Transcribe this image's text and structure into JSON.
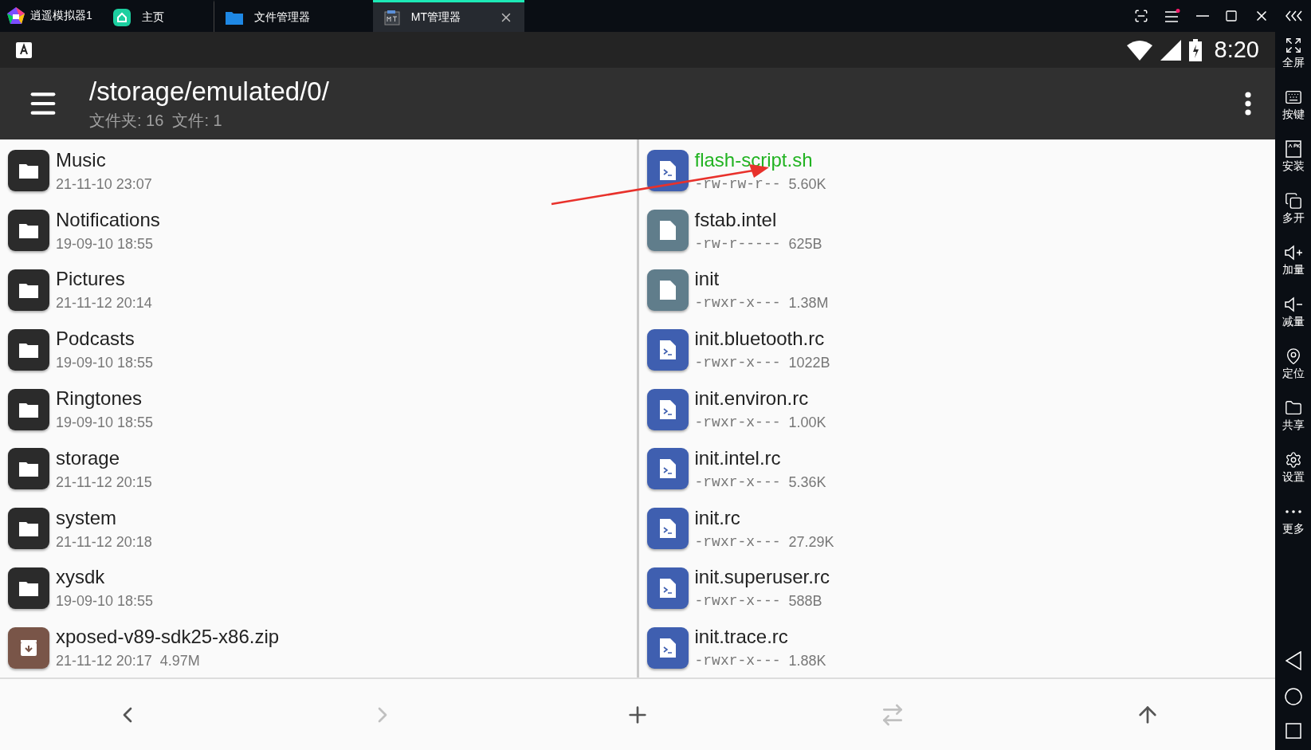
{
  "window": {
    "app_name": "逍遥模拟器1",
    "tabs": [
      {
        "label": "主页",
        "selected": false
      },
      {
        "label": "文件管理器",
        "selected": false
      },
      {
        "label": "MT管理器",
        "selected": true
      }
    ]
  },
  "status_bar": {
    "time": "8:20"
  },
  "toolbar": {
    "path": "/storage/emulated/0/",
    "summary": "文件夹: 16  文件: 1"
  },
  "left_pane": {
    "items": [
      {
        "kind": "folder",
        "name": "Music",
        "meta": "21-11-10 23:07"
      },
      {
        "kind": "folder",
        "name": "Notifications",
        "meta": "19-09-10 18:55"
      },
      {
        "kind": "folder",
        "name": "Pictures",
        "meta": "21-11-12 20:14"
      },
      {
        "kind": "folder",
        "name": "Podcasts",
        "meta": "19-09-10 18:55"
      },
      {
        "kind": "folder",
        "name": "Ringtones",
        "meta": "19-09-10 18:55"
      },
      {
        "kind": "folder",
        "name": "storage",
        "meta": "21-11-12 20:15"
      },
      {
        "kind": "folder",
        "name": "system",
        "meta": "21-11-12 20:18"
      },
      {
        "kind": "folder",
        "name": "xysdk",
        "meta": "19-09-10 18:55"
      },
      {
        "kind": "archive",
        "name": "xposed-v89-sdk25-x86.zip",
        "meta": "21-11-12 20:17  4.97M"
      }
    ]
  },
  "right_pane": {
    "items": [
      {
        "kind": "script",
        "name": "flash-script.sh",
        "permissions": "-rw-rw-r--",
        "size": "5.60K",
        "highlighted": true
      },
      {
        "kind": "file",
        "name": "fstab.intel",
        "permissions": "-rw-r-----",
        "size": "625B",
        "highlighted": false
      },
      {
        "kind": "file",
        "name": "init",
        "permissions": "-rwxr-x---",
        "size": "1.38M",
        "highlighted": false
      },
      {
        "kind": "script",
        "name": "init.bluetooth.rc",
        "permissions": "-rwxr-x---",
        "size": "1022B",
        "highlighted": false
      },
      {
        "kind": "script",
        "name": "init.environ.rc",
        "permissions": "-rwxr-x---",
        "size": "1.00K",
        "highlighted": false
      },
      {
        "kind": "script",
        "name": "init.intel.rc",
        "permissions": "-rwxr-x---",
        "size": "5.36K",
        "highlighted": false
      },
      {
        "kind": "script",
        "name": "init.rc",
        "permissions": "-rwxr-x---",
        "size": "27.29K",
        "highlighted": false
      },
      {
        "kind": "script",
        "name": "init.superuser.rc",
        "permissions": "-rwxr-x---",
        "size": "588B",
        "highlighted": false
      },
      {
        "kind": "script",
        "name": "init.trace.rc",
        "permissions": "-rwxr-x---",
        "size": "1.88K",
        "highlighted": false
      }
    ]
  },
  "bottom_nav": [
    {
      "kind": "back",
      "disabled": false
    },
    {
      "kind": "forward",
      "disabled": true
    },
    {
      "kind": "add",
      "disabled": false
    },
    {
      "kind": "swap",
      "disabled": true
    },
    {
      "kind": "up",
      "disabled": false
    }
  ],
  "side_toolbar": [
    {
      "kind": "fullscreen",
      "label": "全屏"
    },
    {
      "kind": "keyboard",
      "label": "按键"
    },
    {
      "kind": "install",
      "label": "安装"
    },
    {
      "kind": "multi",
      "label": "多开"
    },
    {
      "kind": "volup",
      "label": "加量"
    },
    {
      "kind": "voldown",
      "label": "减量"
    },
    {
      "kind": "location",
      "label": "定位"
    },
    {
      "kind": "share",
      "label": "共享"
    },
    {
      "kind": "settings",
      "label": "设置"
    },
    {
      "kind": "more",
      "label": "更多"
    }
  ]
}
